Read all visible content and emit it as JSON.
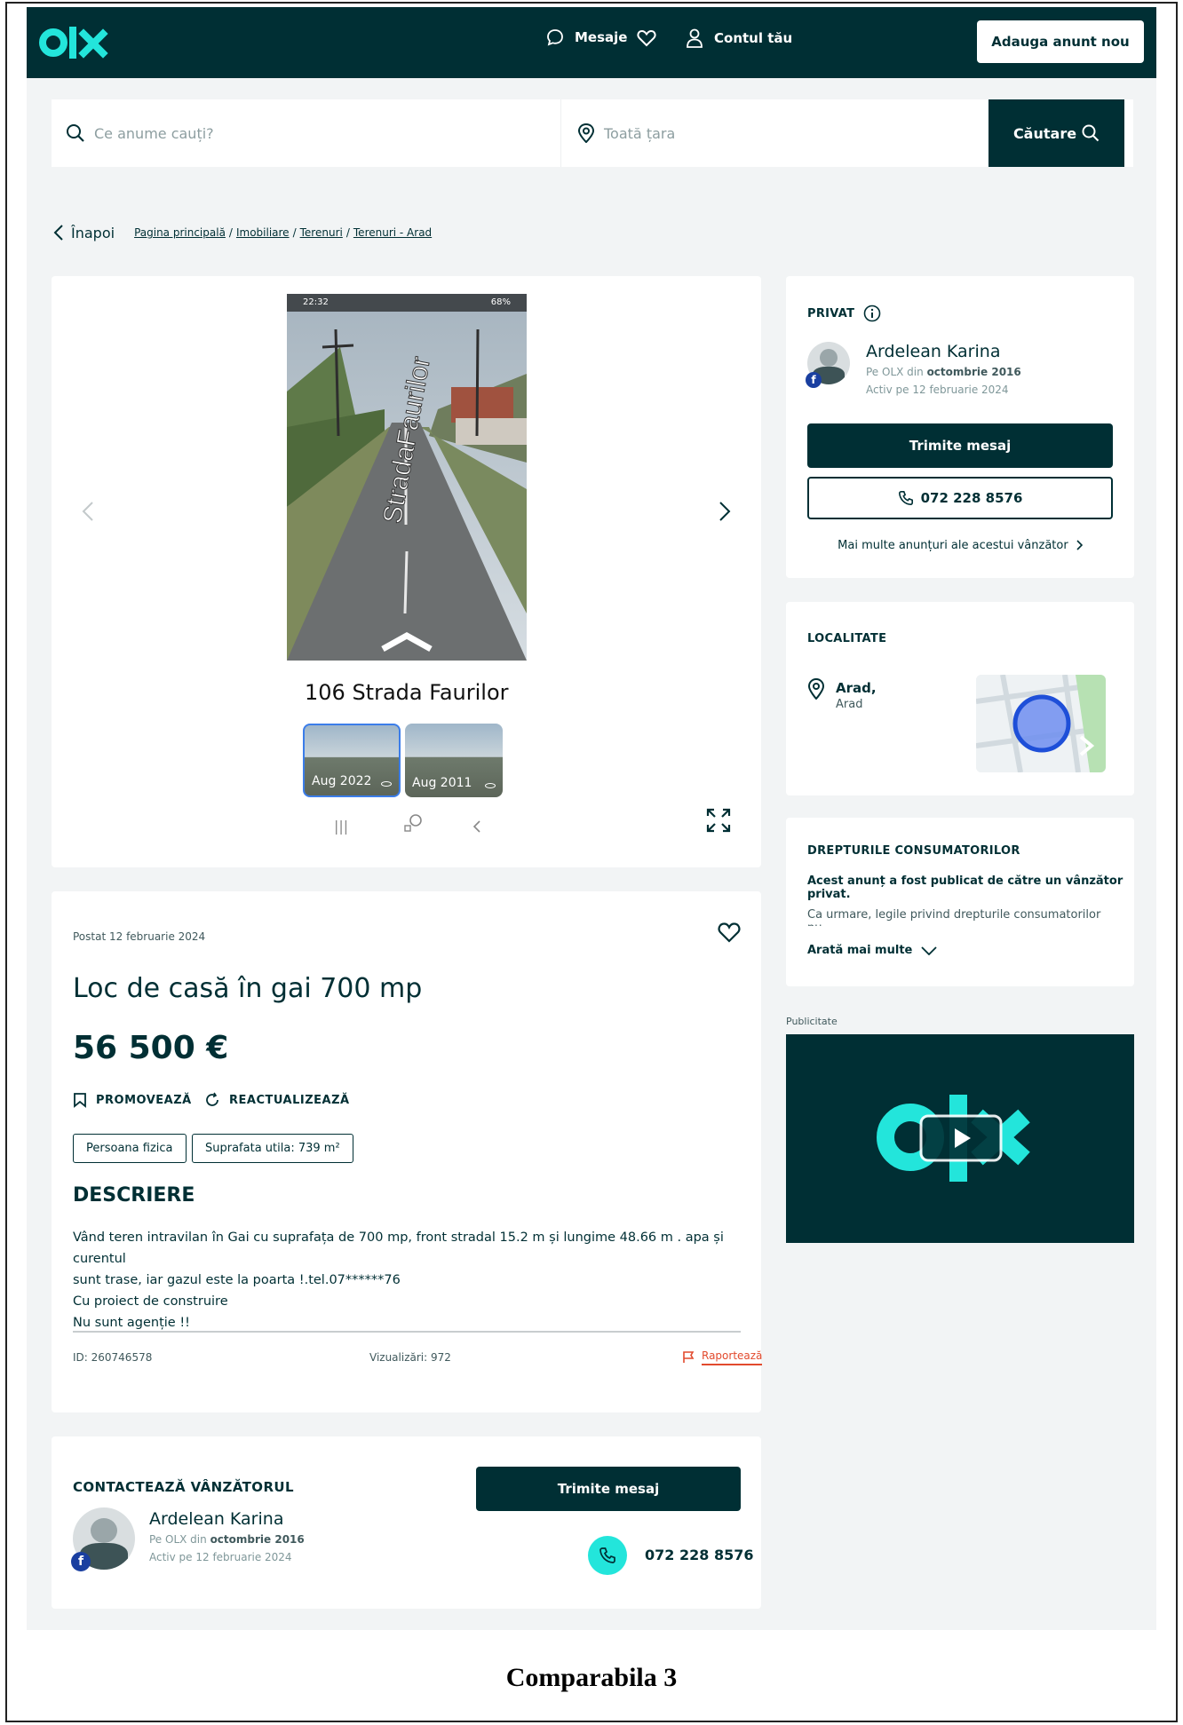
{
  "header": {
    "logo_text": "olx",
    "messages_label": "Mesaje",
    "account_label": "Contul tău",
    "post_ad_label": "Adauga anunt nou"
  },
  "search": {
    "query_placeholder": "Ce anume cauți?",
    "location_placeholder": "Toată țara",
    "button_label": "Căutare"
  },
  "breadcrumb": {
    "back_label": "Înapoi",
    "items": [
      "Pagina principală",
      "Imobiliare",
      "Terenuri",
      "Terenuri - Arad"
    ]
  },
  "gallery": {
    "status_time": "22:32",
    "status_battery": "68%",
    "street_sign": "StradaFaurilor",
    "street_title": "106 Strada Faurilor",
    "thumbnails": [
      "Aug 2022",
      "Aug 2011"
    ]
  },
  "ad": {
    "posted": "Postat 12 februarie 2024",
    "title": "Loc de casă în gai 700 mp",
    "price": "56 500 €",
    "promote_label": "PROMOVEAZĂ",
    "refresh_label": "REACTUALIZEAZĂ",
    "tags": [
      "Persoana fizica",
      "Suprafata utila: 739 m²"
    ],
    "description_heading": "DESCRIERE",
    "description_lines": [
      "Vând teren intravilan în Gai cu suprafața de 700 mp, front stradal 15.2 m și lungime 48.66 m . apa și curentul",
      "sunt trase, iar gazul este la poarta !.tel.07******76",
      "Cu proiect de construire",
      "Nu sunt agenție !!"
    ],
    "id_text": "ID: 260746578",
    "views_text": "Vizualizări: 972",
    "report_label": "Raportează"
  },
  "contact": {
    "heading": "CONTACTEAZĂ VÂNZĂTORUL",
    "send_message_label": "Trimite mesaj",
    "phone": "072 228 8576"
  },
  "seller": {
    "type_label": "PRIVAT",
    "name": "Ardelean Karina",
    "since_prefix": "Pe OLX din",
    "since_date": "octombrie 2016",
    "active": "Activ pe 12 februarie 2024",
    "send_message_label": "Trimite mesaj",
    "phone": "072 228 8576",
    "more_ads_label": "Mai multe anunțuri ale acestui vânzător"
  },
  "location": {
    "heading": "LOCALITATE",
    "city": "Arad,",
    "region": "Arad"
  },
  "consumer_rights": {
    "heading": "DREPTURILE CONSUMATORILOR",
    "bold_text": "Acest anunț a fost publicat de către un vânzător privat.",
    "text": "Ca urmare, legile privind drepturile consumatorilor nu",
    "show_more_label": "Arată mai multe"
  },
  "advertising": {
    "label": "Publicitate"
  },
  "caption": "Comparabila 3",
  "colors": {
    "brand_dark": "#002f34",
    "accent_teal": "#23e5db",
    "report_red": "#e24a2d"
  }
}
